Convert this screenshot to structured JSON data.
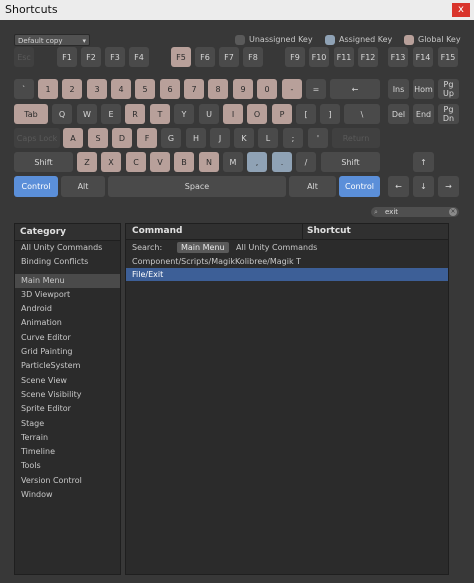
{
  "window": {
    "title": "Shortcuts",
    "close": "x"
  },
  "profile": {
    "selected": "Default copy"
  },
  "legend": [
    {
      "label": "Unassigned Key",
      "color": "#5a5a5a"
    },
    {
      "label": "Assigned Key",
      "color": "#8fa2b5"
    },
    {
      "label": "Global Key",
      "color": "#b8a09a"
    }
  ],
  "keys": [
    {
      "label": "Esc",
      "s": "dis"
    },
    {
      "label": "F1",
      "s": "def"
    },
    {
      "label": "F2",
      "s": "def"
    },
    {
      "label": "F3",
      "s": "def"
    },
    {
      "label": "F4",
      "s": "def"
    },
    {
      "label": "F5",
      "s": "glob"
    },
    {
      "label": "F6",
      "s": "def"
    },
    {
      "label": "F7",
      "s": "def"
    },
    {
      "label": "F8",
      "s": "def"
    },
    {
      "label": "F9",
      "s": "def"
    },
    {
      "label": "F10",
      "s": "def"
    },
    {
      "label": "F11",
      "s": "def"
    },
    {
      "label": "F12",
      "s": "def"
    },
    {
      "label": "F13",
      "s": "def"
    },
    {
      "label": "F14",
      "s": "def"
    },
    {
      "label": "F15",
      "s": "def"
    },
    {
      "label": "`",
      "s": "def"
    },
    {
      "label": "1",
      "s": "glob"
    },
    {
      "label": "2",
      "s": "glob"
    },
    {
      "label": "3",
      "s": "glob"
    },
    {
      "label": "4",
      "s": "glob"
    },
    {
      "label": "5",
      "s": "glob"
    },
    {
      "label": "6",
      "s": "glob"
    },
    {
      "label": "7",
      "s": "glob"
    },
    {
      "label": "8",
      "s": "glob"
    },
    {
      "label": "9",
      "s": "glob"
    },
    {
      "label": "0",
      "s": "glob"
    },
    {
      "label": "-",
      "s": "glob"
    },
    {
      "label": "=",
      "s": "def"
    },
    {
      "label": "←",
      "s": "def"
    },
    {
      "label": "Tab",
      "s": "glob"
    },
    {
      "label": "Q",
      "s": "def"
    },
    {
      "label": "W",
      "s": "def"
    },
    {
      "label": "E",
      "s": "def"
    },
    {
      "label": "R",
      "s": "glob"
    },
    {
      "label": "T",
      "s": "glob"
    },
    {
      "label": "Y",
      "s": "def"
    },
    {
      "label": "U",
      "s": "def"
    },
    {
      "label": "I",
      "s": "glob"
    },
    {
      "label": "O",
      "s": "glob"
    },
    {
      "label": "P",
      "s": "glob"
    },
    {
      "label": "[",
      "s": "def"
    },
    {
      "label": "]",
      "s": "def"
    },
    {
      "label": "\\",
      "s": "def"
    },
    {
      "label": "Caps Lock",
      "s": "dis"
    },
    {
      "label": "A",
      "s": "glob"
    },
    {
      "label": "S",
      "s": "glob"
    },
    {
      "label": "D",
      "s": "glob"
    },
    {
      "label": "F",
      "s": "glob"
    },
    {
      "label": "G",
      "s": "def"
    },
    {
      "label": "H",
      "s": "def"
    },
    {
      "label": "J",
      "s": "def"
    },
    {
      "label": "K",
      "s": "def"
    },
    {
      "label": "L",
      "s": "def"
    },
    {
      "label": ";",
      "s": "def"
    },
    {
      "label": "'",
      "s": "def"
    },
    {
      "label": "Return",
      "s": "dis"
    },
    {
      "label": "Shift",
      "s": "def"
    },
    {
      "label": "Z",
      "s": "glob"
    },
    {
      "label": "X",
      "s": "glob"
    },
    {
      "label": "C",
      "s": "glob"
    },
    {
      "label": "V",
      "s": "glob"
    },
    {
      "label": "B",
      "s": "glob"
    },
    {
      "label": "N",
      "s": "glob"
    },
    {
      "label": "M",
      "s": "def"
    },
    {
      "label": ",",
      "s": "asg"
    },
    {
      "label": ".",
      "s": "asg"
    },
    {
      "label": "/",
      "s": "def"
    },
    {
      "label": "Shift",
      "s": "def"
    },
    {
      "label": "Control",
      "s": "sel"
    },
    {
      "label": "Alt",
      "s": "def"
    },
    {
      "label": "Space",
      "s": "def"
    },
    {
      "label": "Alt",
      "s": "def"
    },
    {
      "label": "Control",
      "s": "sel"
    },
    {
      "label": "Ins",
      "s": "def"
    },
    {
      "label": "Hom",
      "s": "def"
    },
    {
      "label": "Pg\nUp",
      "s": "def"
    },
    {
      "label": "Del",
      "s": "def"
    },
    {
      "label": "End",
      "s": "def"
    },
    {
      "label": "Pg\nDn",
      "s": "def"
    },
    {
      "label": "↑",
      "s": "def"
    },
    {
      "label": "←",
      "s": "def"
    },
    {
      "label": "↓",
      "s": "def"
    },
    {
      "label": "→",
      "s": "def"
    }
  ],
  "search": {
    "value": "exit"
  },
  "categories": {
    "header": "Category",
    "items": [
      "All Unity Commands",
      "Binding Conflicts",
      "Main Menu",
      "3D Viewport",
      "Android",
      "Animation",
      "Curve Editor",
      "Grid Painting",
      "ParticleSystem",
      "Scene View",
      "Scene Visibility",
      "Sprite Editor",
      "Stage",
      "Terrain",
      "Timeline",
      "Tools",
      "Version Control",
      "Window"
    ],
    "selected": "Main Menu"
  },
  "commands": {
    "header_command": "Command",
    "header_shortcut": "Shortcut",
    "search_label": "Search:",
    "scope_main": "Main Menu",
    "scope_all": "All Unity Commands",
    "rows": [
      "Component/Scripts/MagikKolibree/Magik T",
      "File/Exit"
    ],
    "selected": "File/Exit"
  }
}
